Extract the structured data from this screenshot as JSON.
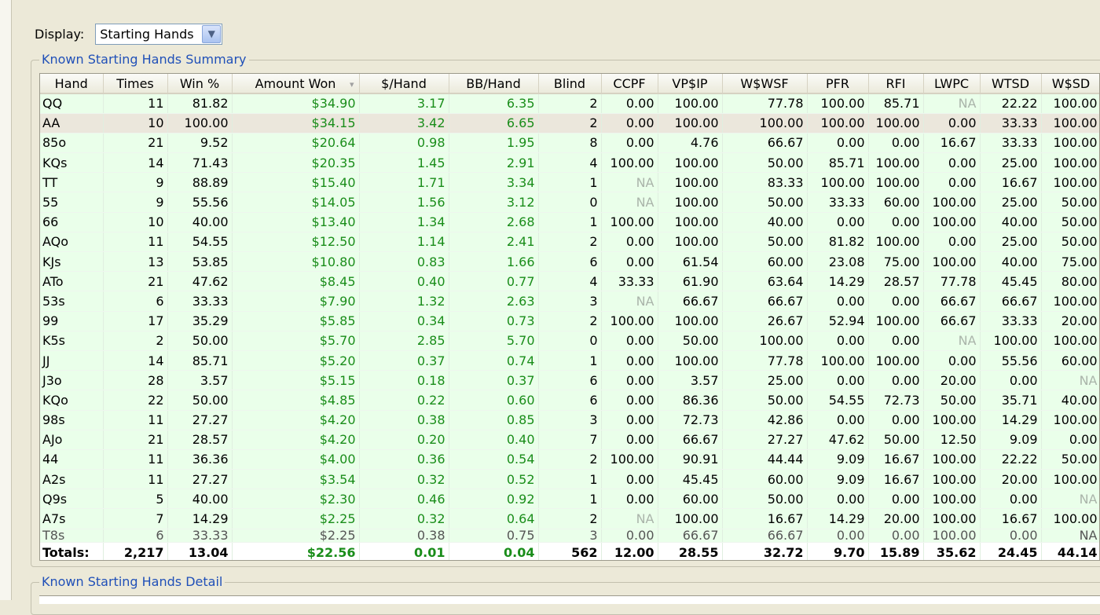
{
  "display": {
    "label": "Display:",
    "selected": "Starting Hands",
    "dropdown_icon": "chevron-down-icon"
  },
  "summary": {
    "title": "Known Starting Hands Summary",
    "columns": [
      "Hand",
      "Times",
      "Win %",
      "Amount Won",
      "$/Hand",
      "BB/Hand",
      "Blind",
      "CCPF",
      "VP$IP",
      "W$WSF",
      "PFR",
      "RFI",
      "LWPC",
      "WTSD",
      "W$SD"
    ],
    "sort_column": "Amount Won",
    "rows": [
      [
        "QQ",
        "11",
        "81.82",
        "$34.90",
        "3.17",
        "6.35",
        "2",
        "0.00",
        "100.00",
        "77.78",
        "100.00",
        "85.71",
        "NA",
        "22.22",
        "100.00"
      ],
      [
        "AA",
        "10",
        "100.00",
        "$34.15",
        "3.42",
        "6.65",
        "2",
        "0.00",
        "100.00",
        "100.00",
        "100.00",
        "100.00",
        "0.00",
        "33.33",
        "100.00"
      ],
      [
        "85o",
        "21",
        "9.52",
        "$20.64",
        "0.98",
        "1.95",
        "8",
        "0.00",
        "4.76",
        "66.67",
        "0.00",
        "0.00",
        "16.67",
        "33.33",
        "100.00"
      ],
      [
        "KQs",
        "14",
        "71.43",
        "$20.35",
        "1.45",
        "2.91",
        "4",
        "100.00",
        "100.00",
        "50.00",
        "85.71",
        "100.00",
        "0.00",
        "25.00",
        "100.00"
      ],
      [
        "TT",
        "9",
        "88.89",
        "$15.40",
        "1.71",
        "3.34",
        "1",
        "NA",
        "100.00",
        "83.33",
        "100.00",
        "100.00",
        "0.00",
        "16.67",
        "100.00"
      ],
      [
        "55",
        "9",
        "55.56",
        "$14.05",
        "1.56",
        "3.12",
        "0",
        "NA",
        "100.00",
        "50.00",
        "33.33",
        "60.00",
        "100.00",
        "25.00",
        "50.00"
      ],
      [
        "66",
        "10",
        "40.00",
        "$13.40",
        "1.34",
        "2.68",
        "1",
        "100.00",
        "100.00",
        "40.00",
        "0.00",
        "0.00",
        "100.00",
        "40.00",
        "50.00"
      ],
      [
        "AQo",
        "11",
        "54.55",
        "$12.50",
        "1.14",
        "2.41",
        "2",
        "0.00",
        "100.00",
        "50.00",
        "81.82",
        "100.00",
        "0.00",
        "25.00",
        "50.00"
      ],
      [
        "KJs",
        "13",
        "53.85",
        "$10.80",
        "0.83",
        "1.66",
        "6",
        "0.00",
        "61.54",
        "60.00",
        "23.08",
        "75.00",
        "100.00",
        "40.00",
        "75.00"
      ],
      [
        "ATo",
        "21",
        "47.62",
        "$8.45",
        "0.40",
        "0.77",
        "4",
        "33.33",
        "61.90",
        "63.64",
        "14.29",
        "28.57",
        "77.78",
        "45.45",
        "80.00"
      ],
      [
        "53s",
        "6",
        "33.33",
        "$7.90",
        "1.32",
        "2.63",
        "3",
        "NA",
        "66.67",
        "66.67",
        "0.00",
        "0.00",
        "66.67",
        "66.67",
        "100.00"
      ],
      [
        "99",
        "17",
        "35.29",
        "$5.85",
        "0.34",
        "0.73",
        "2",
        "100.00",
        "100.00",
        "26.67",
        "52.94",
        "100.00",
        "66.67",
        "33.33",
        "20.00"
      ],
      [
        "K5s",
        "2",
        "50.00",
        "$5.70",
        "2.85",
        "5.70",
        "0",
        "0.00",
        "50.00",
        "100.00",
        "0.00",
        "0.00",
        "NA",
        "100.00",
        "100.00"
      ],
      [
        "JJ",
        "14",
        "85.71",
        "$5.20",
        "0.37",
        "0.74",
        "1",
        "0.00",
        "100.00",
        "77.78",
        "100.00",
        "100.00",
        "0.00",
        "55.56",
        "60.00"
      ],
      [
        "J3o",
        "28",
        "3.57",
        "$5.15",
        "0.18",
        "0.37",
        "6",
        "0.00",
        "3.57",
        "25.00",
        "0.00",
        "0.00",
        "20.00",
        "0.00",
        "NA"
      ],
      [
        "KQo",
        "22",
        "50.00",
        "$4.85",
        "0.22",
        "0.60",
        "6",
        "0.00",
        "86.36",
        "50.00",
        "54.55",
        "72.73",
        "50.00",
        "35.71",
        "40.00"
      ],
      [
        "98s",
        "11",
        "27.27",
        "$4.20",
        "0.38",
        "0.85",
        "3",
        "0.00",
        "72.73",
        "42.86",
        "0.00",
        "0.00",
        "100.00",
        "14.29",
        "100.00"
      ],
      [
        "AJo",
        "21",
        "28.57",
        "$4.20",
        "0.20",
        "0.40",
        "7",
        "0.00",
        "66.67",
        "27.27",
        "47.62",
        "50.00",
        "12.50",
        "9.09",
        "0.00"
      ],
      [
        "44",
        "11",
        "36.36",
        "$4.00",
        "0.36",
        "0.54",
        "2",
        "100.00",
        "90.91",
        "44.44",
        "9.09",
        "16.67",
        "100.00",
        "22.22",
        "50.00"
      ],
      [
        "A2s",
        "11",
        "27.27",
        "$3.54",
        "0.32",
        "0.52",
        "1",
        "0.00",
        "45.45",
        "60.00",
        "9.09",
        "16.67",
        "100.00",
        "20.00",
        "100.00"
      ],
      [
        "Q9s",
        "5",
        "40.00",
        "$2.30",
        "0.46",
        "0.92",
        "1",
        "0.00",
        "60.00",
        "50.00",
        "0.00",
        "0.00",
        "100.00",
        "0.00",
        "NA"
      ],
      [
        "A7s",
        "7",
        "14.29",
        "$2.25",
        "0.32",
        "0.64",
        "2",
        "NA",
        "100.00",
        "16.67",
        "14.29",
        "20.00",
        "100.00",
        "16.67",
        "100.00"
      ],
      [
        "T8s",
        "6",
        "33.33",
        "$2.25",
        "0.38",
        "0.75",
        "3",
        "0.00",
        "66.67",
        "66.67",
        "0.00",
        "0.00",
        "100.00",
        "0.00",
        "NA"
      ]
    ],
    "totals": [
      "Totals:",
      "2,217",
      "13.04",
      "$22.56",
      "0.01",
      "0.04",
      "562",
      "12.00",
      "28.55",
      "32.72",
      "9.70",
      "15.89",
      "35.62",
      "24.45",
      "44.14"
    ]
  },
  "detail": {
    "title": "Known Starting Hands Detail"
  },
  "colors": {
    "row_bg": "#eaffea",
    "selected_row_bg": "#ebe7dc",
    "money_text": "#1a8d1a",
    "group_title": "#2050b8"
  }
}
